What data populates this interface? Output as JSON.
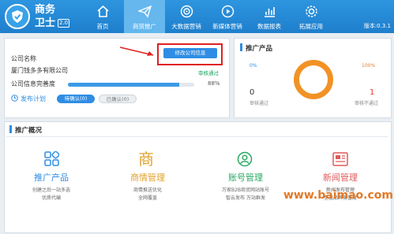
{
  "app": {
    "name_line1": "商务",
    "name_line2": "卫士",
    "version_badge": "2.0",
    "version_text": "版本:0.3.1"
  },
  "nav": [
    {
      "label": "首页",
      "icon": "home-icon"
    },
    {
      "label": "商贸推广",
      "icon": "paper-plane-icon",
      "active": true
    },
    {
      "label": "大数据营销",
      "icon": "target-icon"
    },
    {
      "label": "新媒体营销",
      "icon": "play-icon"
    },
    {
      "label": "数据报表",
      "icon": "chart-icon"
    },
    {
      "label": "拓展应用",
      "icon": "gear-icon"
    }
  ],
  "company": {
    "name_label": "公司名称",
    "name_value": "厦门钱多多有限公司",
    "edit_button": "修改公司信息",
    "review_status": "审核通过",
    "completeness_label": "公司信息完善度",
    "completeness_percent": 88,
    "completeness_text": "88%",
    "plan_label": "发布计划",
    "pending_button": "待确认(0)",
    "confirmed_button": "已确认(0)"
  },
  "promo_products": {
    "title": "推广产品",
    "left_pct": "0%",
    "right_pct": "100%",
    "approved_count": "0",
    "approved_label": "审核通过",
    "rejected_count": "1",
    "rejected_label": "审核不通过"
  },
  "overview": {
    "title": "推广概况",
    "cards": [
      {
        "title": "推广产品",
        "line1": "创建之后一站多选",
        "line2": "优质代编",
        "color": "#2f8de4",
        "icon": "grid-icon"
      },
      {
        "title": "商情管理",
        "line1": "商情推送优化",
        "line2": "全网覆盖",
        "color": "#e0a12c",
        "icon": "shang-character-icon"
      },
      {
        "title": "账号管理",
        "line1": "万家B2B商贸网站账号",
        "line2": "智云发布 万站群发",
        "color": "#2aa864",
        "icon": "user-icon"
      },
      {
        "title": "新闻管理",
        "line1": "新闻发布管理",
        "line2": "塑造品牌美誉度",
        "color": "#e05a5a",
        "icon": "newspaper-icon"
      }
    ]
  },
  "watermark": "www.baimao.com",
  "colors": {
    "topbar": "#2a8fdc",
    "accent": "#2f8de4",
    "ring": "#f29225"
  }
}
